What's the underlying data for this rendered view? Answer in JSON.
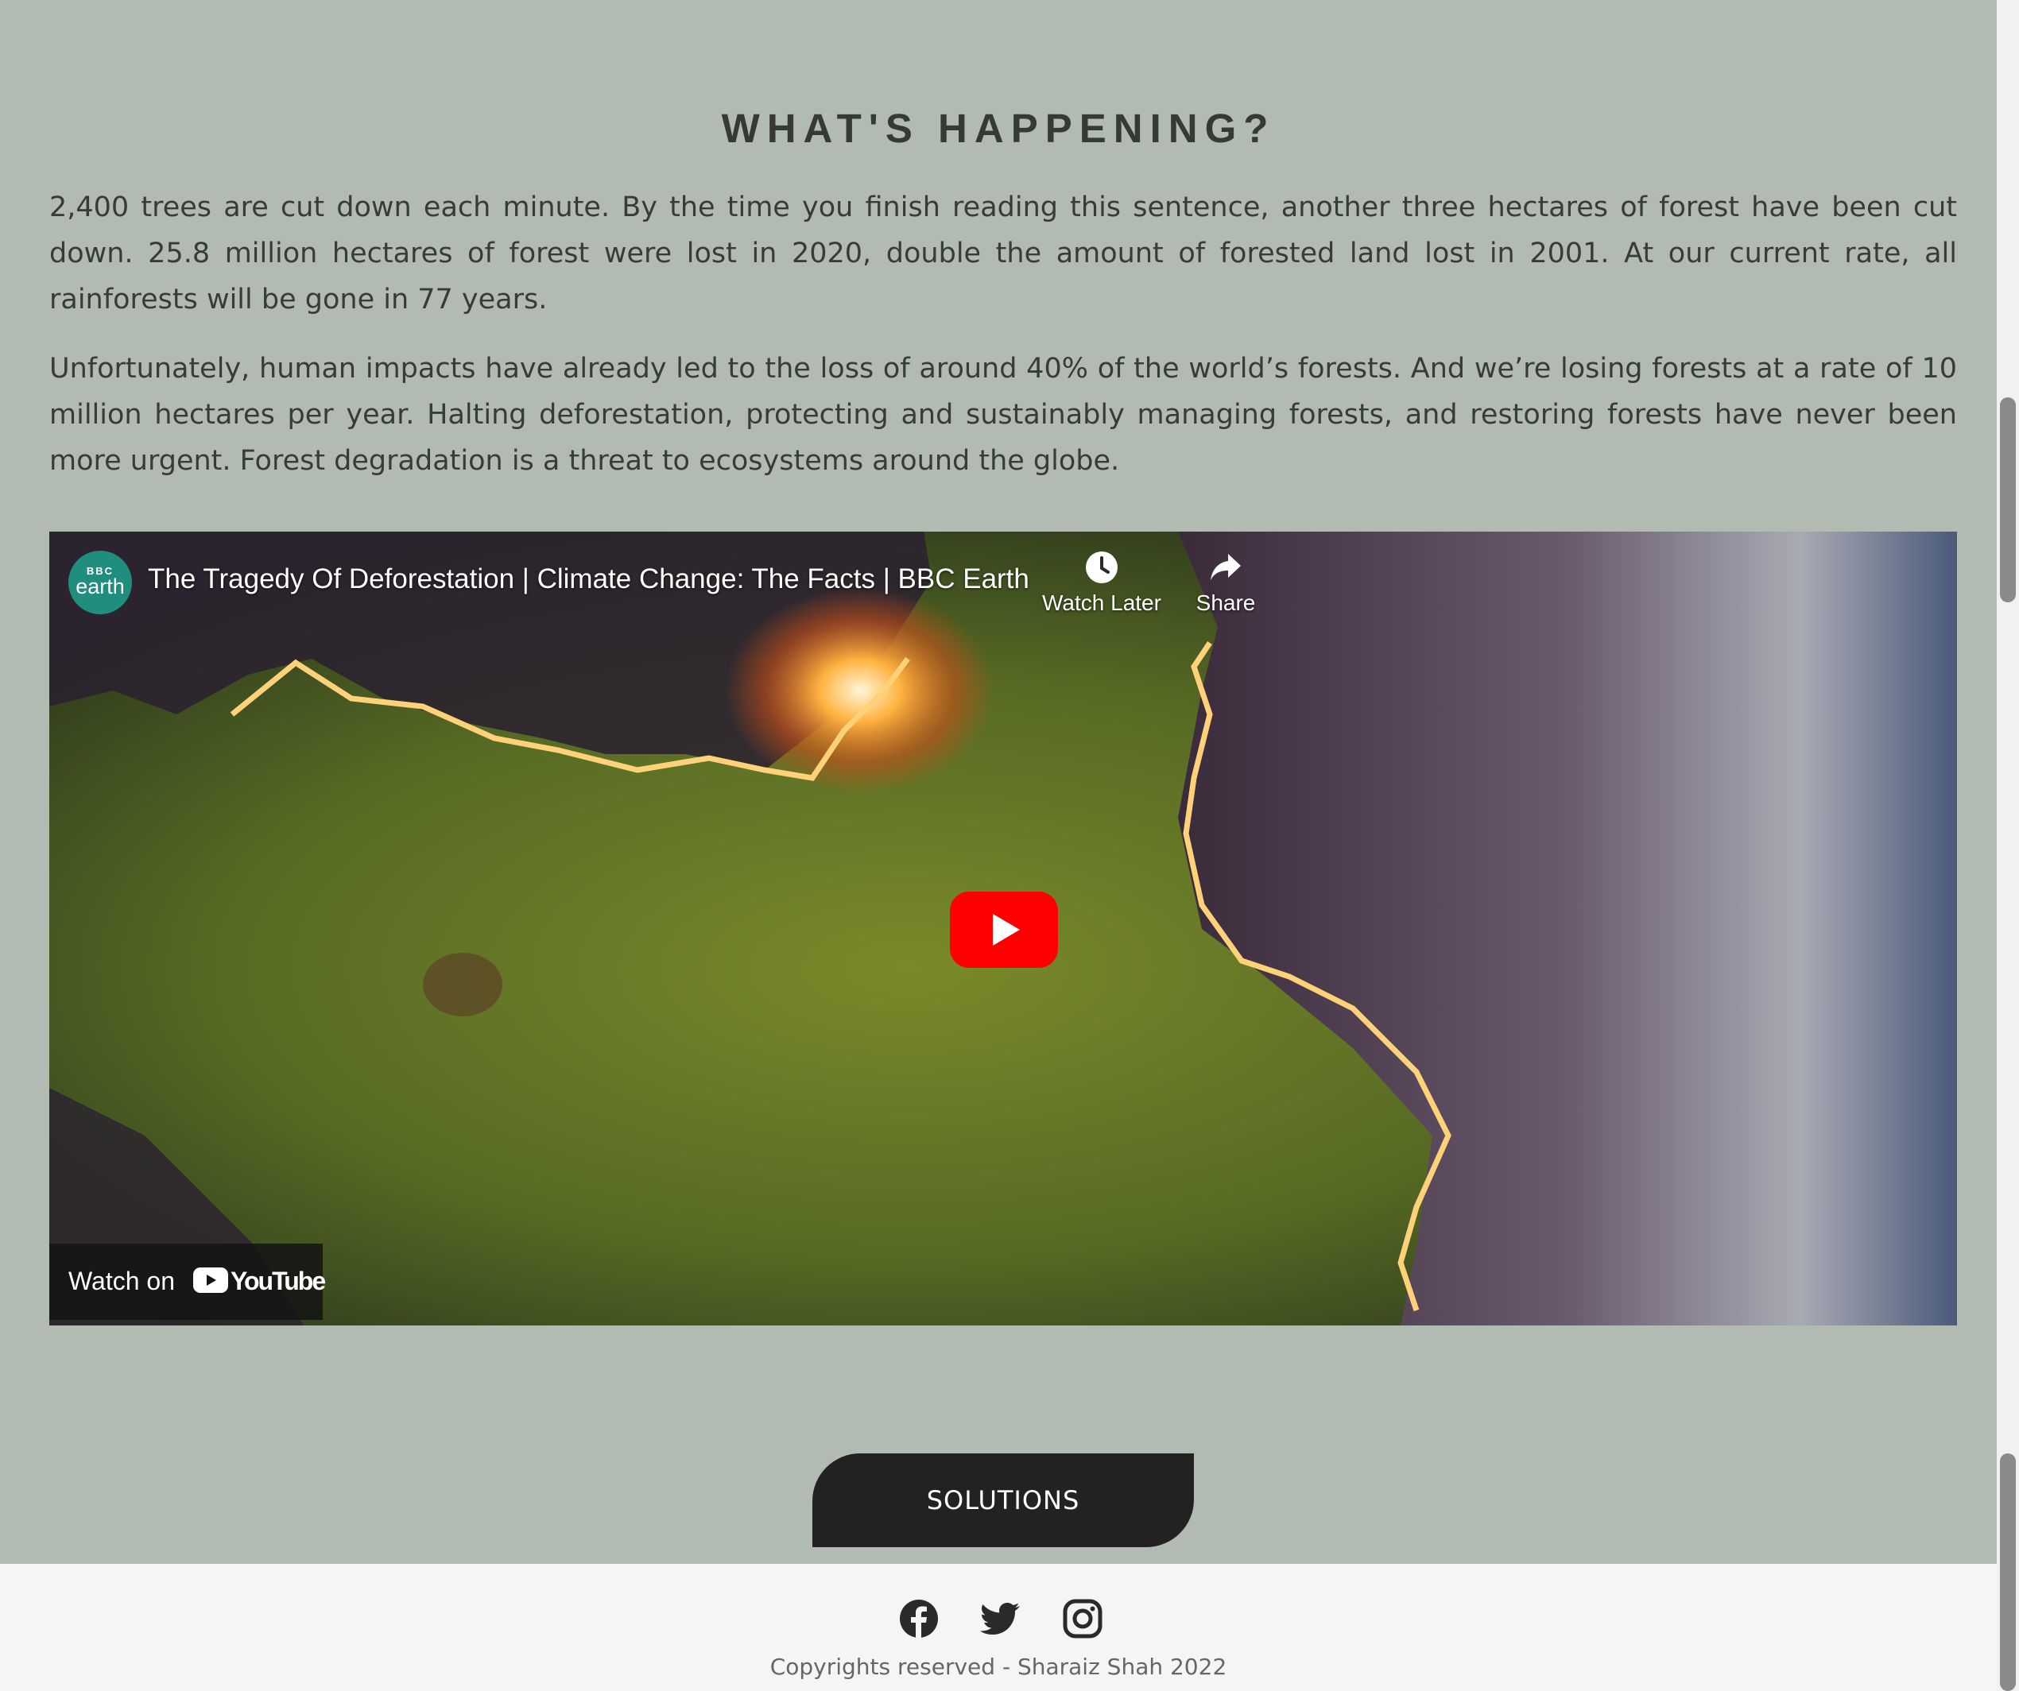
{
  "section": {
    "heading": "WHAT'S HAPPENING?",
    "paragraphs": [
      "2,400 trees are cut down each minute. By the time you finish reading this sentence, another three hectares of forest have been cut down. 25.8 million hectares of forest were lost in 2020, double the amount of forested land lost in 2001. At our current rate, all rainforests will be gone in 77 years.",
      "Unfortunately, human impacts have already led to the loss of around 40% of the world’s forests. And we’re losing forests at a rate of 10 million hectares per year. Halting deforestation, protecting and sustainably managing forests, and restoring forests have never been more urgent. Forest degradation is a threat to ecosystems around the globe."
    ]
  },
  "video": {
    "channel_logo": {
      "line1": "BBC",
      "line2": "earth"
    },
    "title": "The Tragedy Of Deforestation | Climate Change: The Facts | BBC Earth",
    "watch_later_label": "Watch Later",
    "share_label": "Share",
    "watch_on_label": "Watch on",
    "youtube_wordmark": "YouTube",
    "icons": [
      "clock-icon",
      "share-arrow-icon",
      "play-icon",
      "youtube-logo-icon"
    ],
    "play_button_color": "#ff0000"
  },
  "cta": {
    "solutions_label": "SOLUTIONS"
  },
  "footer": {
    "social": [
      "facebook-icon",
      "twitter-icon",
      "instagram-icon"
    ],
    "copyright": "Copyrights reserved - Sharaiz Shah 2022"
  },
  "colors": {
    "page_background": "#b1bbb2",
    "heading_text": "#363936",
    "body_text": "#383c39",
    "button_background": "#212221",
    "footer_background": "#f5f5f5"
  }
}
